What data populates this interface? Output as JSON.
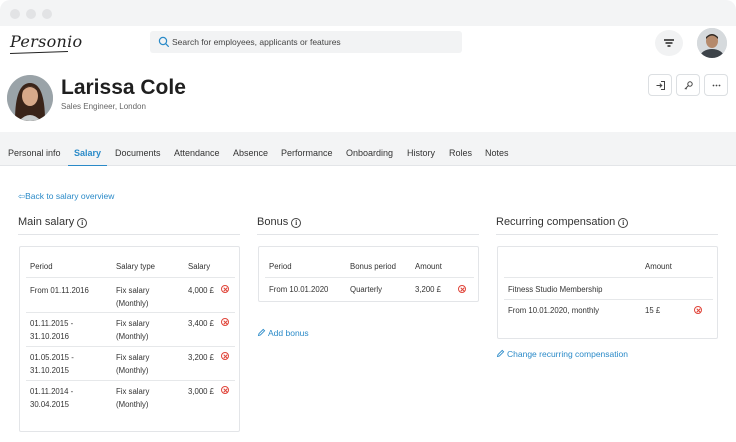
{
  "app": {
    "logo_text": "Personio"
  },
  "search": {
    "placeholder": "Search for employees, applicants or features"
  },
  "profile": {
    "name": "Larissa Cole",
    "subtitle": "Sales Engineer, London"
  },
  "tabs": [
    {
      "label": "Personal info"
    },
    {
      "label": "Salary"
    },
    {
      "label": "Documents"
    },
    {
      "label": "Attendance"
    },
    {
      "label": "Absence"
    },
    {
      "label": "Performance"
    },
    {
      "label": "Onboarding"
    },
    {
      "label": "History"
    },
    {
      "label": "Roles"
    },
    {
      "label": "Notes"
    }
  ],
  "back_link": "Back to salary overview",
  "main_salary": {
    "title": "Main salary",
    "headers": [
      "Period",
      "Salary type",
      "Salary"
    ],
    "rows": [
      {
        "period": "From 01.11.2016",
        "type": "Fix salary (Monthly)",
        "salary": "4,000 £"
      },
      {
        "period": "01.11.2015 - 31.10.2016",
        "type": "Fix salary (Monthly)",
        "salary": "3,400 £"
      },
      {
        "period": "01.05.2015 - 31.10.2015",
        "type": "Fix salary (Monthly)",
        "salary": "3,200 £"
      },
      {
        "period": "01.11.2014 - 30.04.2015",
        "type": "Fix salary (Monthly)",
        "salary": "3,000 £"
      }
    ]
  },
  "bonus": {
    "title": "Bonus",
    "headers": [
      "Period",
      "Bonus period",
      "Amount"
    ],
    "rows": [
      {
        "period": "From 10.01.2020",
        "bonus_period": "Quarterly",
        "amount": "3,200 £"
      }
    ],
    "add_link": "Add bonus"
  },
  "recurring": {
    "title": "Recurring compensation",
    "headers": [
      "",
      "Amount"
    ],
    "group": "Fitness Studio Membership",
    "rows": [
      {
        "period": "From 10.01.2020, monthly",
        "amount": "15 £"
      }
    ],
    "change_link": "Change recurring compensation"
  },
  "colors": {
    "accent": "#2a8ac8",
    "delete": "#e0453a",
    "tab_bar_bg": "#f3f4f5"
  },
  "icons": [
    "search-icon",
    "filter-icon",
    "login-icon",
    "key-icon",
    "more-icon",
    "info-icon",
    "delete-icon",
    "pencil-icon"
  ]
}
